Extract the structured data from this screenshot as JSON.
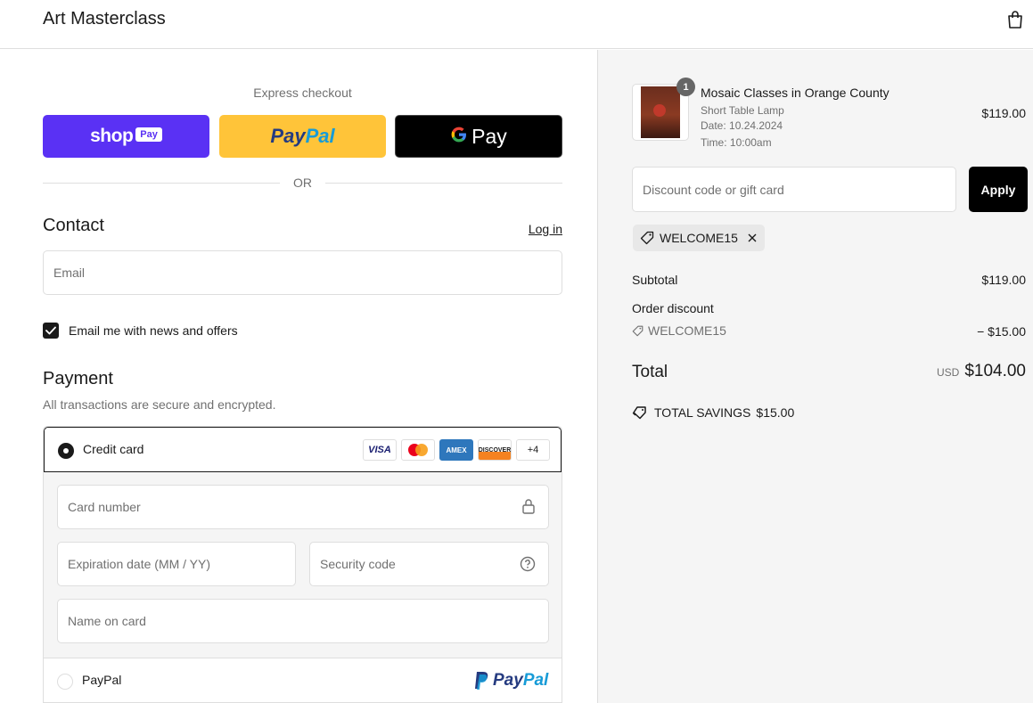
{
  "header": {
    "brand": "Art Masterclass"
  },
  "express": {
    "label": "Express checkout",
    "shop_pay": {
      "word": "shop",
      "badge": "Pay",
      "color": "#5a31f4"
    },
    "paypal": {
      "part1": "Pay",
      "part2": "Pal",
      "color": "#ffc439"
    },
    "gpay": {
      "g": "G",
      "word": "Pay"
    },
    "or": "OR"
  },
  "contact": {
    "title": "Contact",
    "login": "Log in",
    "email_placeholder": "Email",
    "newsletter_label": "Email me with news and offers",
    "newsletter_checked": true
  },
  "payment": {
    "title": "Payment",
    "subtitle": "All transactions are secure and encrypted.",
    "credit_card_label": "Credit card",
    "card_logos": [
      "VISA",
      "MC",
      "AMEX",
      "DISCOVER"
    ],
    "more_cards": "+4",
    "card_number_placeholder": "Card number",
    "expiry_placeholder": "Expiration date (MM / YY)",
    "security_placeholder": "Security code",
    "name_placeholder": "Name on card",
    "paypal_label": "PayPal",
    "paypal_logo_part1": "Pay",
    "paypal_logo_part2": "Pal"
  },
  "order": {
    "item": {
      "quantity": "1",
      "name": "Mosaic Classes in Orange County",
      "variant": "Short Table Lamp",
      "date": "Date: 10.24.2024",
      "time": "Time: 10:00am",
      "price": "$119.00"
    },
    "discount_placeholder": "Discount code or gift card",
    "apply": "Apply",
    "applied_code": "WELCOME15",
    "subtotal_label": "Subtotal",
    "subtotal": "$119.00",
    "discount_label": "Order discount",
    "discount_code": "WELCOME15",
    "discount_amount": "− $15.00",
    "total_label": "Total",
    "currency": "USD",
    "total": "$104.00",
    "savings_label": "TOTAL SAVINGS",
    "savings_amount": "$15.00"
  }
}
